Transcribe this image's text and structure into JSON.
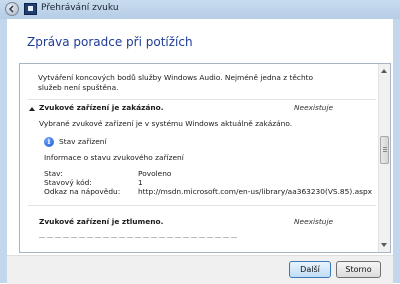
{
  "window": {
    "title": "Přehrávání zvuku"
  },
  "dialog": {
    "heading": "Zpráva poradce při potížích"
  },
  "report": {
    "intro_line1": "Vytváření koncových bodů služby Windows Audio. Nejméně jedna z těchto",
    "intro_line2": "služeb není spuštěna.",
    "issue1": {
      "title": "Zvukové zařízení je zakázáno.",
      "status": "Neexistuje",
      "description": "Vybrané zvukové zařízení je v systému Windows aktuálně zakázáno.",
      "link": "Stav zařízení",
      "info": "Informace o stavu zvukového zařízení",
      "rows": [
        {
          "label": "Stav:",
          "value": "Povoleno"
        },
        {
          "label": "Stavový kód:",
          "value": "1"
        },
        {
          "label": "Odkaz na nápovědu:",
          "value": "http://msdn.microsoft.com/en-us/library/aa363230(VS.85).aspx"
        }
      ]
    },
    "issue2": {
      "title": "Zvukové zařízení je ztlumeno.",
      "status": "Neexistuje"
    }
  },
  "buttons": {
    "next": "Další",
    "cancel": "Storno"
  }
}
